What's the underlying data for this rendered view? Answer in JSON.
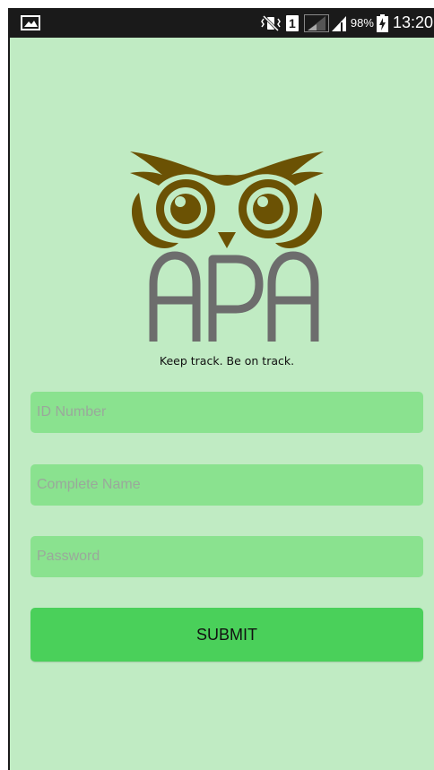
{
  "status_bar": {
    "sim_slot": "1",
    "battery_percent": "98%",
    "time": "13:20"
  },
  "logo": {
    "text": "APA",
    "tagline": "Keep track. Be on track."
  },
  "form": {
    "id_placeholder": "ID Number",
    "name_placeholder": "Complete Name",
    "password_placeholder": "Password",
    "submit_label": "SUBMIT"
  },
  "colors": {
    "background": "#c0ebc3",
    "field": "#8ae28f",
    "button": "#4ad05a",
    "owl": "#6b5204",
    "logo_text": "#6d6d6d"
  }
}
